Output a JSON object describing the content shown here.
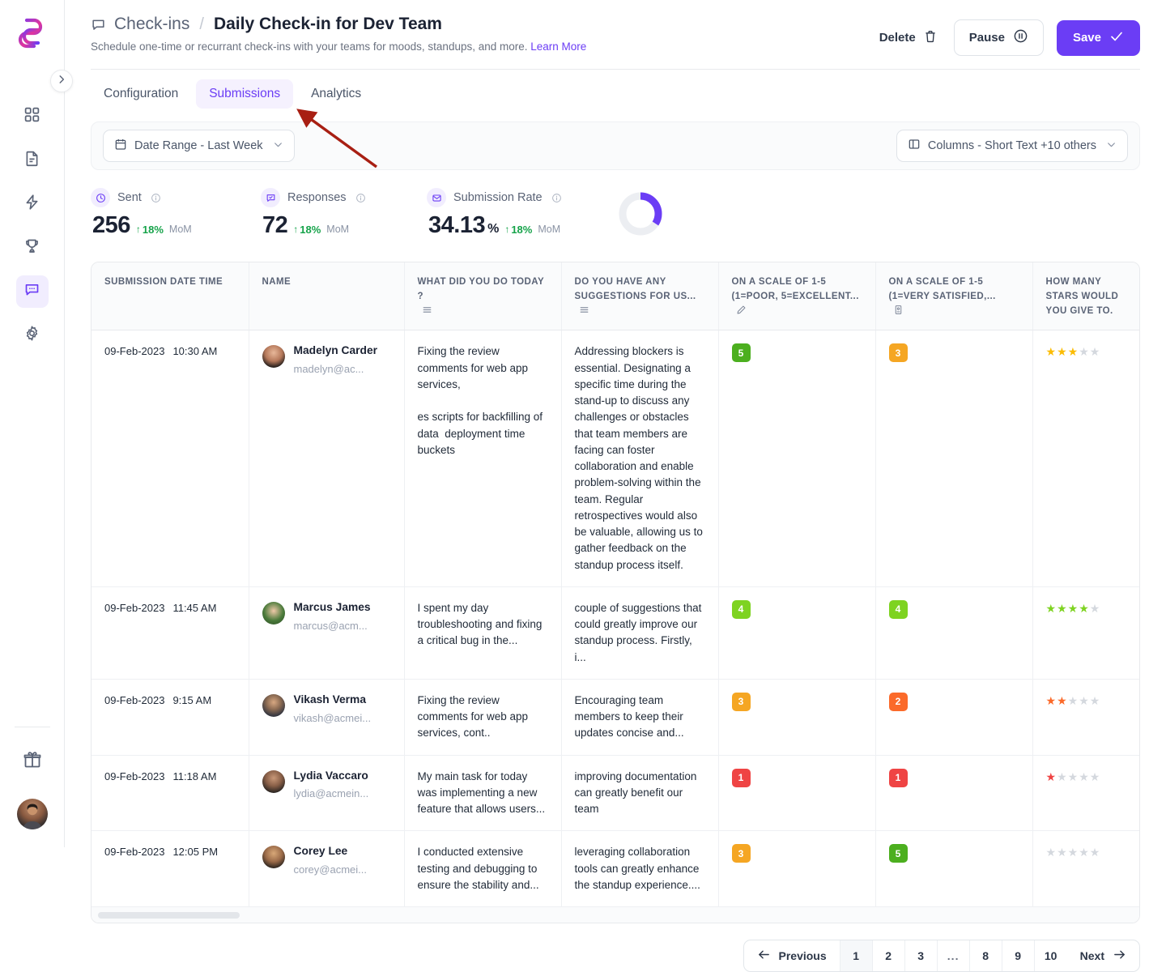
{
  "sidebar": {
    "logo_name": "logo-icon",
    "items": [
      {
        "icon": "grid-icon",
        "name": "sidebar-item-dashboard",
        "active": false
      },
      {
        "icon": "document-icon",
        "name": "sidebar-item-documents",
        "active": false
      },
      {
        "icon": "lightning-icon",
        "name": "sidebar-item-automations",
        "active": false
      },
      {
        "icon": "trophy-icon",
        "name": "sidebar-item-rewards",
        "active": false
      },
      {
        "icon": "chat-icon",
        "name": "sidebar-item-checkins",
        "active": true
      },
      {
        "icon": "gear-icon",
        "name": "sidebar-item-settings",
        "active": false
      }
    ],
    "gift_icon": "gift-icon",
    "expand_icon": "chevron-right-icon",
    "avatar": "user-avatar"
  },
  "header": {
    "breadcrumb_icon": "chat-icon",
    "breadcrumb_parent": "Check-ins",
    "breadcrumb_separator": "/",
    "title": "Daily Check-in for Dev Team",
    "subtitle": "Schedule one-time or recurrant check-ins with your teams for moods, standups, and more.",
    "subtitle_link": "Learn More",
    "delete_label": "Delete",
    "delete_icon": "trash-icon",
    "pause_label": "Pause",
    "pause_icon": "pause-circle-icon",
    "save_label": "Save",
    "save_icon": "check-icon",
    "save_color": "#6b3df5"
  },
  "tabs": [
    {
      "label": "Configuration",
      "active": false
    },
    {
      "label": "Submissions",
      "active": true
    },
    {
      "label": "Analytics",
      "active": false
    }
  ],
  "filters": {
    "date_range_label": "Date Range - Last Week",
    "date_range_icon": "calendar-icon",
    "columns_label": "Columns - Short Text +10 others",
    "columns_icon": "columns-icon",
    "chevron_icon": "chevron-down-icon"
  },
  "stats": [
    {
      "label": "Sent",
      "icon": "clock-icon",
      "value": "256",
      "suffix": "",
      "delta": "18%",
      "delta_arrow": "↑",
      "period": "MoM"
    },
    {
      "label": "Responses",
      "icon": "message-check-icon",
      "value": "72",
      "suffix": "",
      "delta": "18%",
      "delta_arrow": "↑",
      "period": "MoM"
    },
    {
      "label": "Submission Rate",
      "icon": "envelope-icon",
      "value": "34.13",
      "suffix": "%",
      "delta": "18%",
      "delta_arrow": "↑",
      "period": "MoM"
    }
  ],
  "donut": {
    "percent": 34.13,
    "color": "#6b3df5",
    "track": "#eceef2"
  },
  "table": {
    "columns": [
      {
        "label": "SUBMISSION DATE TIME",
        "icon": null
      },
      {
        "label": "NAME",
        "icon": null
      },
      {
        "label": "WHAT DID YOU DO TODAY ?",
        "icon": "list-icon"
      },
      {
        "label": "DO YOU HAVE ANY SUGGESTIONS FOR US...",
        "icon": "list-icon"
      },
      {
        "label": "ON A SCALE OF 1-5 (1=POOR, 5=EXCELLENT...",
        "icon": "pencil-icon"
      },
      {
        "label": "ON A SCALE OF 1-5 (1=VERY SATISFIED,...",
        "icon": "rating-scale-icon"
      },
      {
        "label": "HOW MANY STARS WOULD YOU GIVE TO.",
        "icon": null
      }
    ],
    "rows": [
      {
        "date": "09-Feb-2023",
        "time": "10:30 AM",
        "name": "Madelyn Carder",
        "email": "madelyn@ac...",
        "today": "Fixing the review comments for web app services,\n\nes scripts for backfilling of data  deployment time buckets",
        "suggestions": "Addressing blockers is essential. Designating a specific time during the stand-up to discuss any challenges or obstacles that team members are facing can foster collaboration and enable problem-solving within the team. Regular retrospectives would also be valuable, allowing us to gather feedback on the standup process itself.",
        "score1": 5,
        "score2": 3,
        "stars": 3
      },
      {
        "date": "09-Feb-2023",
        "time": "11:45 AM",
        "name": "Marcus James",
        "email": "marcus@acm...",
        "today": "I spent my day troubleshooting and fixing a critical bug in the...",
        "suggestions": "couple of suggestions that could greatly improve our standup process. Firstly, i...",
        "score1": 4,
        "score2": 4,
        "stars": 4
      },
      {
        "date": "09-Feb-2023",
        "time": "9:15 AM",
        "name": "Vikash Verma",
        "email": "vikash@acmei...",
        "today": "Fixing the review comments for web app services, cont..",
        "suggestions": "Encouraging team members to keep their updates concise and...",
        "score1": 3,
        "score2": 2,
        "stars": 2
      },
      {
        "date": "09-Feb-2023",
        "time": "11:18 AM",
        "name": "Lydia Vaccaro",
        "email": "lydia@acmein...",
        "today": "My main task for today was implementing a new feature that allows users...",
        "suggestions": "improving documentation can greatly benefit our team",
        "score1": 1,
        "score2": 1,
        "stars": 1
      },
      {
        "date": "09-Feb-2023",
        "time": "12:05 PM",
        "name": "Corey Lee",
        "email": "corey@acmei...",
        "today": "I conducted extensive testing and debugging to ensure the stability and...",
        "suggestions": "leveraging collaboration tools can greatly enhance the standup experience....",
        "score1": 3,
        "score2": 5,
        "stars": 0
      }
    ],
    "score_colors": {
      "1": "#ef4444",
      "2": "#fb6a2a",
      "3": "#f5a623",
      "4": "#7ed321",
      "5": "#4caf1f"
    }
  },
  "pagination": {
    "previous_label": "Previous",
    "previous_icon": "arrow-left-icon",
    "next_label": "Next",
    "next_icon": "arrow-right-icon",
    "pages": [
      "1",
      "2",
      "3",
      "...",
      "8",
      "9",
      "10"
    ],
    "active_page": "1"
  },
  "annotation": {
    "color": "#a81f13",
    "target": "Submissions tab"
  }
}
